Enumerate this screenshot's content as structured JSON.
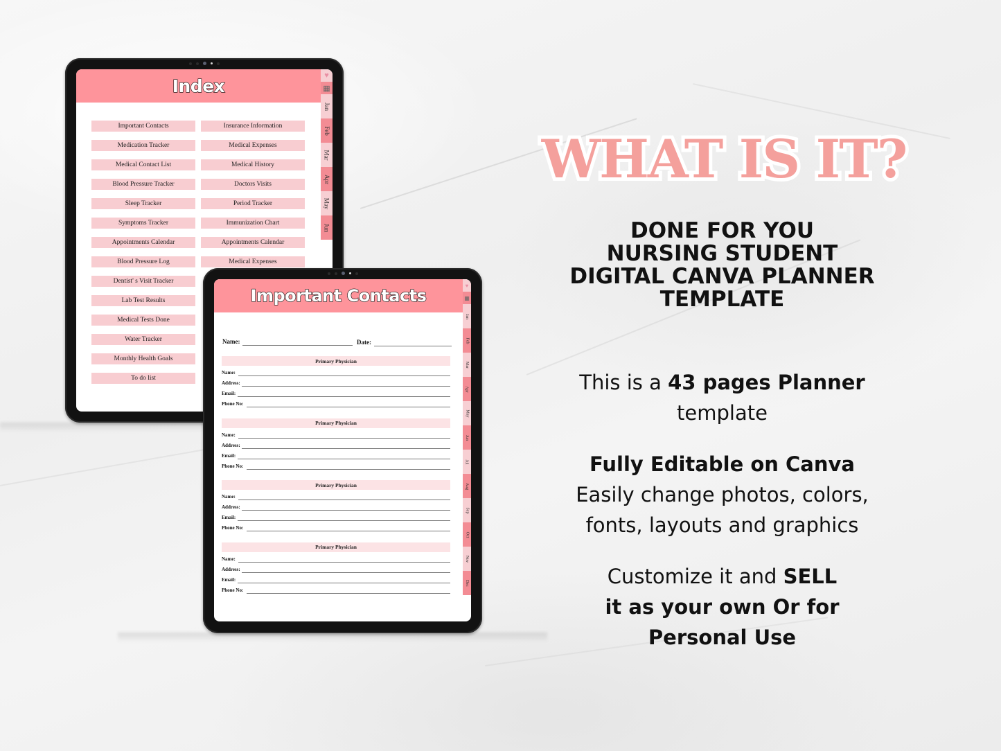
{
  "colors": {
    "header_pink": "#fe949b",
    "tab_dark": "#f38c94",
    "tab_light": "#f7cfd3",
    "index_item_bg": "#f8cdd1",
    "section_bar_bg": "#fce3e5",
    "headline": "#f4a09c",
    "text": "#111111"
  },
  "tablet_index": {
    "title": "Index",
    "side_tabs": {
      "icons": [
        "heart-icon",
        "calendar-icon"
      ],
      "months": [
        "Jan",
        "Feb",
        "Mar",
        "Apr",
        "May",
        "Jun"
      ]
    },
    "left_column": [
      "Important Contacts",
      "Medication Tracker",
      "Medical Contact List",
      "Blood Pressure Tracker",
      "Sleep Tracker",
      "Symptoms Tracker",
      "Appointments Calendar",
      "Blood Pressure Log",
      "Dentist' s Visit Tracker",
      "Lab Test Results",
      "Medical Tests Done",
      "Water Tracker",
      "Monthly Health Goals",
      "To do list"
    ],
    "right_column": [
      "Insurance Information",
      "Medical Expenses",
      "Medical History",
      "Doctors Visits",
      "Period Tracker",
      "Immunization Chart",
      "Appointments Calendar",
      "Medical Expenses"
    ]
  },
  "tablet_contacts": {
    "title": "Important Contacts",
    "name_label": "Name:",
    "date_label": "Date:",
    "side_tabs": {
      "icons": [
        "heart-icon",
        "calendar-icon"
      ],
      "months": [
        "Jan",
        "Feb",
        "Mar",
        "Apr",
        "May",
        "Jun",
        "Jul",
        "Aug",
        "Sep",
        "Oct",
        "Nov",
        "Dec"
      ]
    },
    "sections": [
      {
        "title": "Primary Physician",
        "fields": [
          "Name:",
          "Address:",
          "Email:",
          "Phone No:"
        ]
      },
      {
        "title": "Primary Physician",
        "fields": [
          "Name:",
          "Address:",
          "Email:",
          "Phone No:"
        ]
      },
      {
        "title": "Primary Physician",
        "fields": [
          "Name:",
          "Address:",
          "Email:",
          "Phone No:"
        ]
      },
      {
        "title": "Primary Physician",
        "fields": [
          "Name:",
          "Address:",
          "Email:",
          "Phone No:"
        ]
      }
    ]
  },
  "promo": {
    "headline": "WHAT IS IT?",
    "title_lines": [
      "DONE FOR YOU",
      "NURSING STUDENT",
      "DIGITAL CANVA PLANNER",
      "TEMPLATE"
    ],
    "pages": {
      "prefix": "This is a ",
      "bold": "43 pages Planner",
      "suffix": "template"
    },
    "editable": {
      "bold": "Fully Editable on Canva",
      "line2": "Easily change photos, colors,",
      "line3": "fonts, layouts and graphics"
    },
    "sell": {
      "prefix": "Customize it and ",
      "bold1": "SELL",
      "bold2": "it as your own Or for",
      "bold3": "Personal Use"
    }
  }
}
